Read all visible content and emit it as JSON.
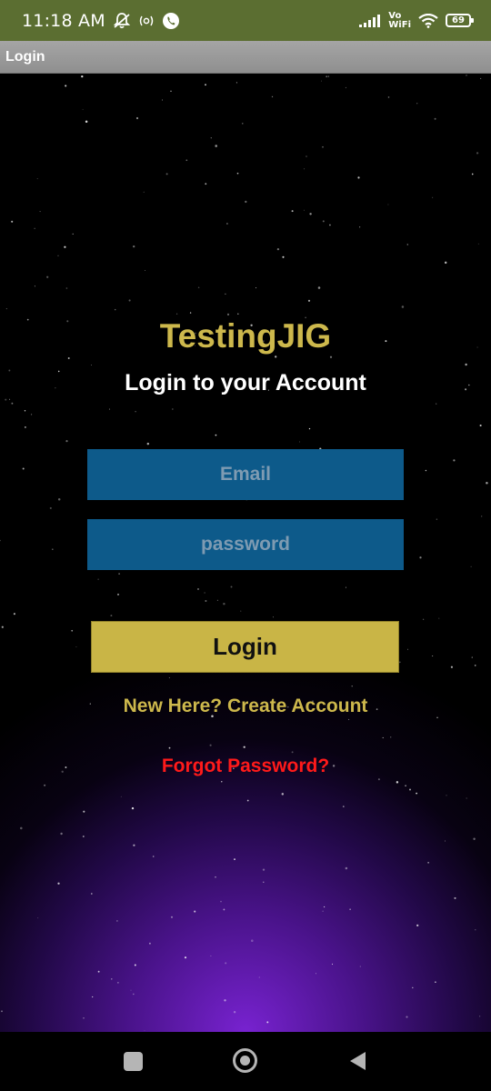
{
  "status_bar": {
    "time": "11:18 AM",
    "battery_level": "69",
    "network_label_top": "Vo",
    "network_label_bottom": "WiFi"
  },
  "action_bar": {
    "title": "Login"
  },
  "login": {
    "app_name": "TestingJIG",
    "subtitle": "Login to your Account",
    "email_placeholder": "Email",
    "password_placeholder": "password",
    "login_label": "Login",
    "create_account_label": "New Here? Create Account",
    "forgot_password_label": "Forgot Password?"
  },
  "colors": {
    "status_bar_bg": "#5b6e31",
    "accent_gold": "#cdb84c",
    "field_blue": "#0d5a8a",
    "button_gold": "#c9b546",
    "forgot_red": "#ff1a1a",
    "glow_purple": "#7a23d4"
  },
  "icons": {
    "status_left": [
      "mute-notifications-icon",
      "hotspot-icon",
      "whatsapp-icon"
    ],
    "status_right": [
      "signal-icon",
      "vowifi-icon",
      "wifi-icon",
      "battery-icon"
    ],
    "nav": [
      "recents-icon",
      "home-icon",
      "back-icon"
    ]
  }
}
